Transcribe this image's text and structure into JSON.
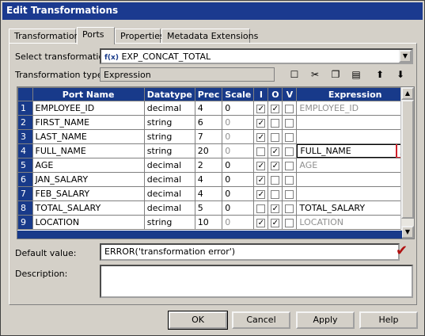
{
  "window": {
    "title": "Edit Transformations"
  },
  "tabs": [
    {
      "label": "Transformation"
    },
    {
      "label": "Ports"
    },
    {
      "label": "Properties"
    },
    {
      "label": "Metadata Extensions"
    }
  ],
  "select_transformation": {
    "label": "Select transformation:",
    "icon_text": "f(x)",
    "value": "EXP_CONCAT_TOTAL"
  },
  "transformation_type": {
    "label": "Transformation type:",
    "value": "Expression"
  },
  "toolbar": [
    "new-port-icon",
    "cut-icon",
    "copy-icon",
    "paste-icon",
    "move-up-icon",
    "move-down-icon"
  ],
  "grid": {
    "columns": [
      "Port Name",
      "Datatype",
      "Prec",
      "Scale",
      "I",
      "O",
      "V",
      "Expression"
    ],
    "rows": [
      {
        "num": "1",
        "name": "EMPLOYEE_ID",
        "type": "decimal",
        "prec": "4",
        "scale": "0",
        "scale_dim": false,
        "i": true,
        "o": true,
        "v": false,
        "expr": "EMPLOYEE_ID",
        "expr_dim": true
      },
      {
        "num": "2",
        "name": "FIRST_NAME",
        "type": "string",
        "prec": "6",
        "scale": "0",
        "scale_dim": true,
        "i": true,
        "o": false,
        "v": false,
        "expr": "",
        "expr_dim": false
      },
      {
        "num": "3",
        "name": "LAST_NAME",
        "type": "string",
        "prec": "7",
        "scale": "0",
        "scale_dim": true,
        "i": true,
        "o": false,
        "v": false,
        "expr": "",
        "expr_dim": false
      },
      {
        "num": "4",
        "name": "FULL_NAME",
        "type": "string",
        "prec": "20",
        "scale": "0",
        "scale_dim": true,
        "i": false,
        "o": true,
        "v": false,
        "expr": "FULL_NAME",
        "expr_dim": false
      },
      {
        "num": "5",
        "name": "AGE",
        "type": "decimal",
        "prec": "2",
        "scale": "0",
        "scale_dim": false,
        "i": true,
        "o": true,
        "v": false,
        "expr": "AGE",
        "expr_dim": true
      },
      {
        "num": "6",
        "name": "JAN_SALARY",
        "type": "decimal",
        "prec": "4",
        "scale": "0",
        "scale_dim": false,
        "i": true,
        "o": false,
        "v": false,
        "expr": "",
        "expr_dim": false
      },
      {
        "num": "7",
        "name": "FEB_SALARY",
        "type": "decimal",
        "prec": "4",
        "scale": "0",
        "scale_dim": false,
        "i": true,
        "o": false,
        "v": false,
        "expr": "",
        "expr_dim": false
      },
      {
        "num": "8",
        "name": "TOTAL_SALARY",
        "type": "decimal",
        "prec": "5",
        "scale": "0",
        "scale_dim": false,
        "i": false,
        "o": true,
        "v": false,
        "expr": "TOTAL_SALARY",
        "expr_dim": false
      },
      {
        "num": "9",
        "name": "LOCATION",
        "type": "string",
        "prec": "10",
        "scale": "0",
        "scale_dim": true,
        "i": true,
        "o": true,
        "v": false,
        "expr": "LOCATION",
        "expr_dim": true
      }
    ]
  },
  "default_value": {
    "label": "Default value:",
    "value": "ERROR('transformation error')"
  },
  "description": {
    "label": "Description:",
    "value": ""
  },
  "buttons": {
    "ok": "OK",
    "cancel": "Cancel",
    "apply": "Apply",
    "help": "Help"
  },
  "colors": {
    "header": "#183a8a",
    "title": "#1b3a8f",
    "highlight": "#d0202a"
  }
}
